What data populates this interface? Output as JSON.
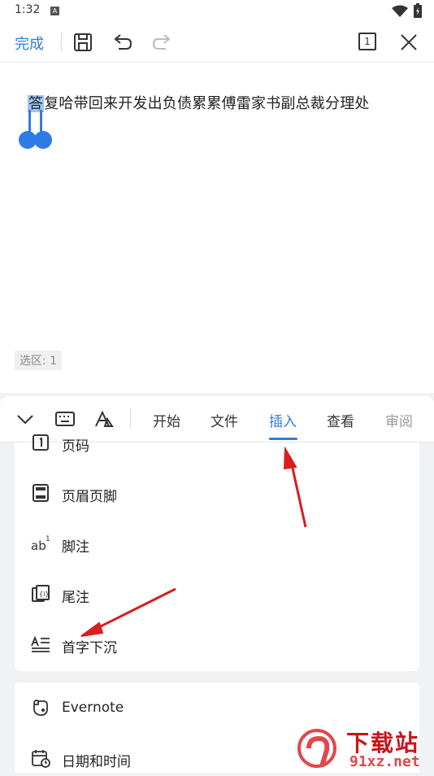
{
  "status_bar": {
    "time": "1:32",
    "notif_icon": "A"
  },
  "toolbar": {
    "done_label": "完成",
    "page_indicator": "1"
  },
  "document": {
    "first_char": "答",
    "text_rest": "复哈带回来开发出负债累累傅雷家书副总裁分理处",
    "selection_info": "选区: 1"
  },
  "panel": {
    "tabs": [
      {
        "label": "开始"
      },
      {
        "label": "文件"
      },
      {
        "label": "插入",
        "active": true
      },
      {
        "label": "查看"
      },
      {
        "label": "审阅"
      }
    ],
    "insert_items": [
      {
        "label": "页码",
        "icon": "page-number-icon"
      },
      {
        "label": "页眉页脚",
        "icon": "header-footer-icon"
      },
      {
        "label": "脚注",
        "icon": "footnote-icon"
      },
      {
        "label": "尾注",
        "icon": "endnote-icon"
      },
      {
        "label": "首字下沉",
        "icon": "drop-cap-icon"
      }
    ],
    "more_items": [
      {
        "label": "Evernote",
        "icon": "evernote-icon"
      },
      {
        "label": "日期和时间",
        "icon": "datetime-icon"
      }
    ]
  },
  "colors": {
    "accent": "#2f7be6",
    "arrow": "#d81e1e"
  },
  "watermark": {
    "text_big": "下载站",
    "text_small": "91xz.net"
  }
}
